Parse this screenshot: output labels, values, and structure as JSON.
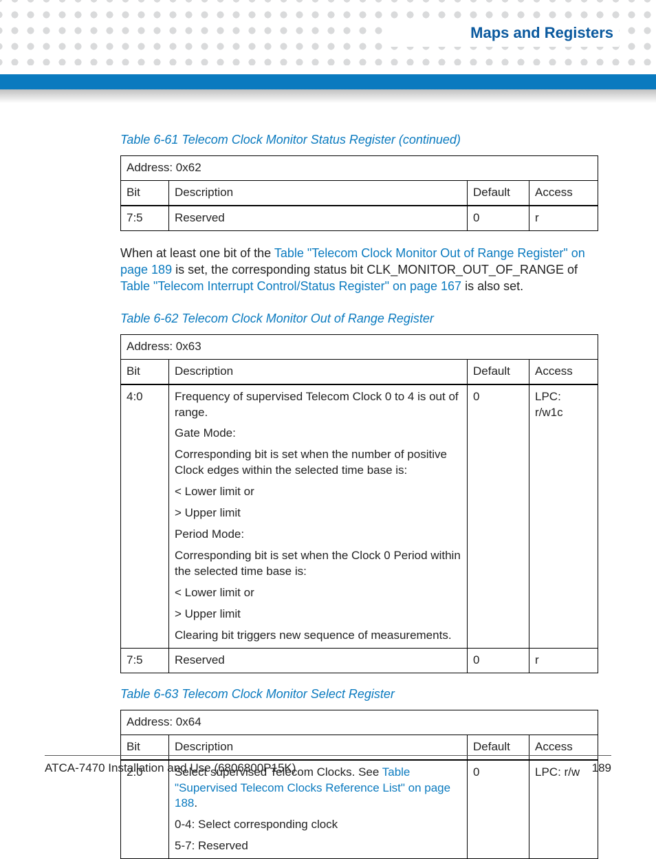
{
  "section_title": "Maps and Registers",
  "table61": {
    "caption": "Table 6-61 Telecom Clock Monitor Status Register (continued)",
    "address": "Address: 0x62",
    "headers": {
      "bit": "Bit",
      "desc": "Description",
      "def": "Default",
      "access": "Access"
    },
    "rows": [
      {
        "bit": "7:5",
        "desc": "Reserved",
        "def": "0",
        "access": "r"
      }
    ]
  },
  "para1": {
    "t1": "When at least one bit of the ",
    "link1": "Table \"Telecom Clock Monitor Out of Range Register\" on page 189",
    "t2": " is set, the corresponding status bit CLK_MONITOR_OUT_OF_RANGE of ",
    "link2": "Table \"Telecom Interrupt Control/Status Register\" on page 167",
    "t3": " is also set."
  },
  "table62": {
    "caption": "Table 6-62 Telecom Clock Monitor Out of Range Register",
    "address": "Address: 0x63",
    "headers": {
      "bit": "Bit",
      "desc": "Description",
      "def": "Default",
      "access": "Access"
    },
    "row1": {
      "bit": "4:0",
      "p1": "Frequency of supervised Telecom Clock 0 to 4 is out of range.",
      "p2": "Gate Mode:",
      "p3": "Corresponding bit is set when the number of positive Clock edges within the selected time base is:",
      "p4": " < Lower limit or",
      "p5": "> Upper limit",
      "p6": "Period Mode:",
      "p7": "Corresponding bit is set when the Clock 0 Period within the selected time base is:",
      "p8": " < Lower limit or",
      "p9": "> Upper limit",
      "p10": "Clearing bit triggers new sequence of measurements.",
      "def": "0",
      "access": "LPC: r/w1c"
    },
    "row2": {
      "bit": "7:5",
      "desc": "Reserved",
      "def": "0",
      "access": "r"
    }
  },
  "table63": {
    "caption": "Table 6-63 Telecom Clock Monitor Select Register",
    "address": "Address: 0x64",
    "headers": {
      "bit": "Bit",
      "desc": "Description",
      "def": "Default",
      "access": "Access"
    },
    "row1": {
      "bit": "2:0",
      "t1": "Select supervised Telecom Clocks. See ",
      "link1": "Table \"Supervised Telecom Clocks Reference List\" on page 188",
      "t2": ".",
      "p2": "0-4: Select corresponding clock",
      "p3": "5-7: Reserved",
      "def": "0",
      "access": "LPC: r/w"
    }
  },
  "footer": {
    "left": "ATCA-7470 Installation and Use (6806800P15K)",
    "right": "189"
  }
}
